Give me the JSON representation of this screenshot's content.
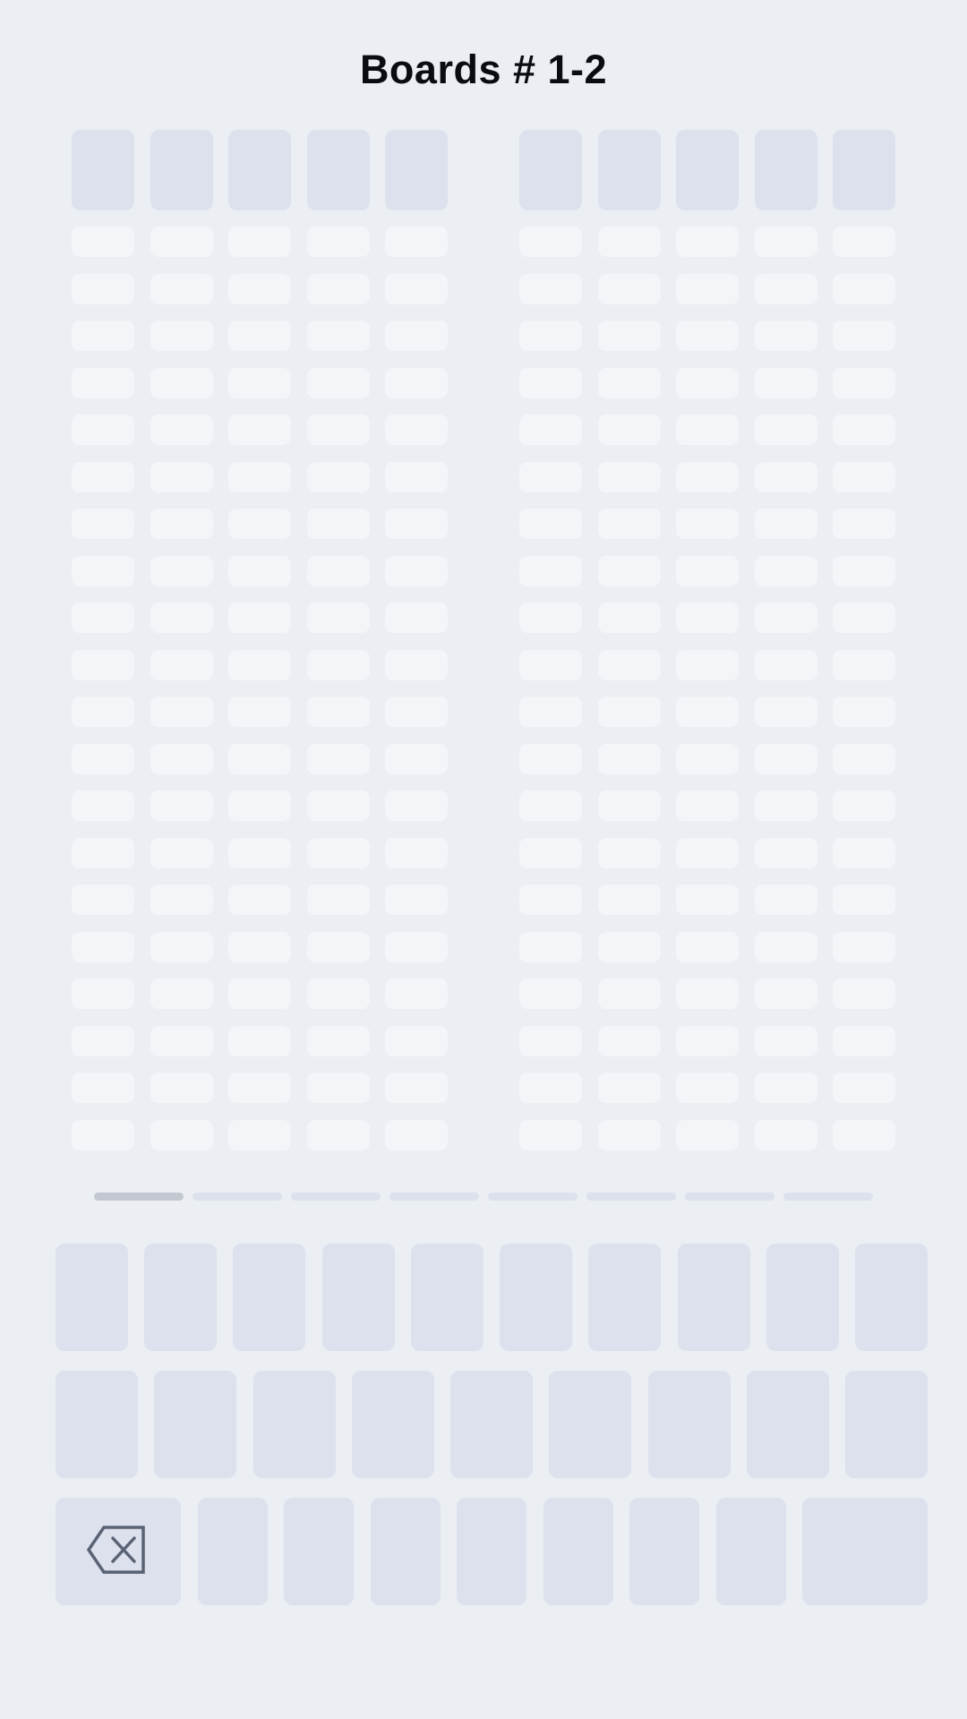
{
  "header": {
    "title": "Boards # 1-2"
  },
  "boards": [
    {
      "id": "board-1",
      "columns": 5,
      "rows": 20
    },
    {
      "id": "board-2",
      "columns": 5,
      "rows": 20
    }
  ],
  "pager": {
    "pages": 8,
    "active_index": 0
  },
  "keyboard": {
    "row1_key_count": 10,
    "row2_key_count": 9,
    "row3_key_count": 9,
    "backspace_icon": "backspace-icon"
  },
  "colors": {
    "background": "#ebeef2",
    "tile": "#dce1ed",
    "cell": "#f3f5f9",
    "page_active": "#c3c8d0",
    "icon": "#5a6275"
  }
}
